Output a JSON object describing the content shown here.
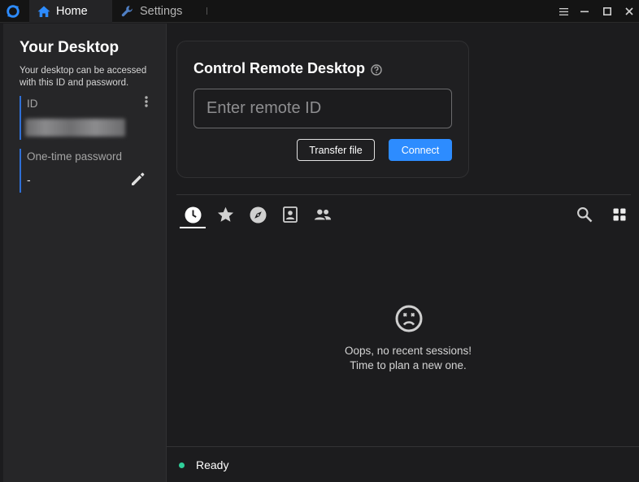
{
  "titlebar": {
    "logo_icon": "app-logo-ring",
    "tabs": [
      {
        "label": "Home",
        "icon": "home-icon",
        "active": true
      },
      {
        "label": "Settings",
        "icon": "wrench-icon",
        "active": false
      }
    ],
    "window_controls": [
      "menu-icon",
      "minimize-icon",
      "maximize-icon",
      "close-icon"
    ]
  },
  "left_panel": {
    "title": "Your Desktop",
    "description": "Your desktop can be accessed with this ID and password.",
    "id_label": "ID",
    "id_value_obscured": true,
    "password_label": "One-time password",
    "password_value": "-"
  },
  "control": {
    "title": "Control Remote Desktop",
    "input_placeholder": "Enter remote ID",
    "input_value": "",
    "transfer_label": "Transfer file",
    "connect_label": "Connect"
  },
  "session_tabs": {
    "icons": [
      "recent-clock-icon",
      "favorites-star-icon",
      "discovered-compass-icon",
      "address-book-icon",
      "group-icon"
    ],
    "active": "recent-clock-icon",
    "right_icons": [
      "search-icon",
      "grid-view-icon"
    ]
  },
  "empty_state": {
    "icon": "sad-face-icon",
    "line1": "Oops, no recent sessions!",
    "line2": "Time to plan a new one."
  },
  "status": {
    "text": "Ready",
    "dot_color": "#2fcf9a"
  },
  "colors": {
    "accent": "#2d8cff",
    "panel_border": "#2f6fd6",
    "background": "#1c1c1e"
  }
}
